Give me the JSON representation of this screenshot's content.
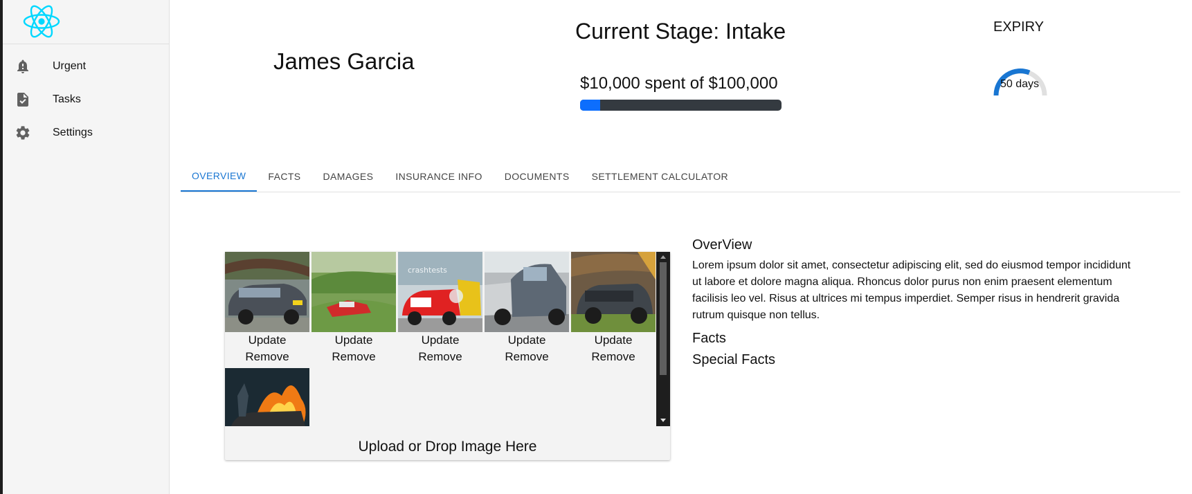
{
  "sidebar": {
    "items": [
      {
        "label": "Urgent",
        "icon": "bell-alert-icon"
      },
      {
        "label": "Tasks",
        "icon": "clipboard-check-icon"
      },
      {
        "label": "Settings",
        "icon": "gear-icon"
      }
    ]
  },
  "header": {
    "client_name": "James Garcia",
    "stage": "Current Stage: Intake",
    "budget_text": "$10,000 spent of $100,000",
    "budget_spent_fraction": 0.1,
    "expiry_label": "EXPIRY",
    "expiry_value": "50 days"
  },
  "tabs": [
    {
      "label": "OVERVIEW",
      "active": true
    },
    {
      "label": "FACTS"
    },
    {
      "label": "DAMAGES"
    },
    {
      "label": "INSURANCE INFO"
    },
    {
      "label": "DOCUMENTS"
    },
    {
      "label": "SETTLEMENT CALCULATOR"
    }
  ],
  "gallery": {
    "update_label": "Update",
    "remove_label": "Remove",
    "upload_label": "Upload or Drop Image Here",
    "photos": [
      {
        "subject": "car crushed under fallen tree",
        "banner_text": ""
      },
      {
        "subject": "red car crashed on green hillside",
        "banner_text": ""
      },
      {
        "subject": "red car crash test",
        "banner_text": "crashtests"
      },
      {
        "subject": "two damaged cars after collision",
        "banner_text": ""
      },
      {
        "subject": "car front under fallen tree trunk",
        "banner_text": ""
      },
      {
        "subject": "car on fire",
        "banner_text": ""
      }
    ]
  },
  "overview": {
    "heading": "OverView",
    "body": "Lorem ipsum dolor sit amet, consectetur adipiscing elit, sed do eiusmod tempor incididunt ut labore et dolore magna aliqua. Rhoncus dolor purus non enim praesent elementum facilisis leo vel. Risus at ultrices mi tempus imperdiet. Semper risus in hendrerit gravida rutrum quisque non tellus.",
    "facts_heading": "Facts",
    "special_facts_heading": "Special Facts"
  },
  "colors": {
    "accent": "#1976d2",
    "progress_fill": "#0d6efd",
    "progress_track": "#343a40",
    "logo": "#00d8ff"
  }
}
